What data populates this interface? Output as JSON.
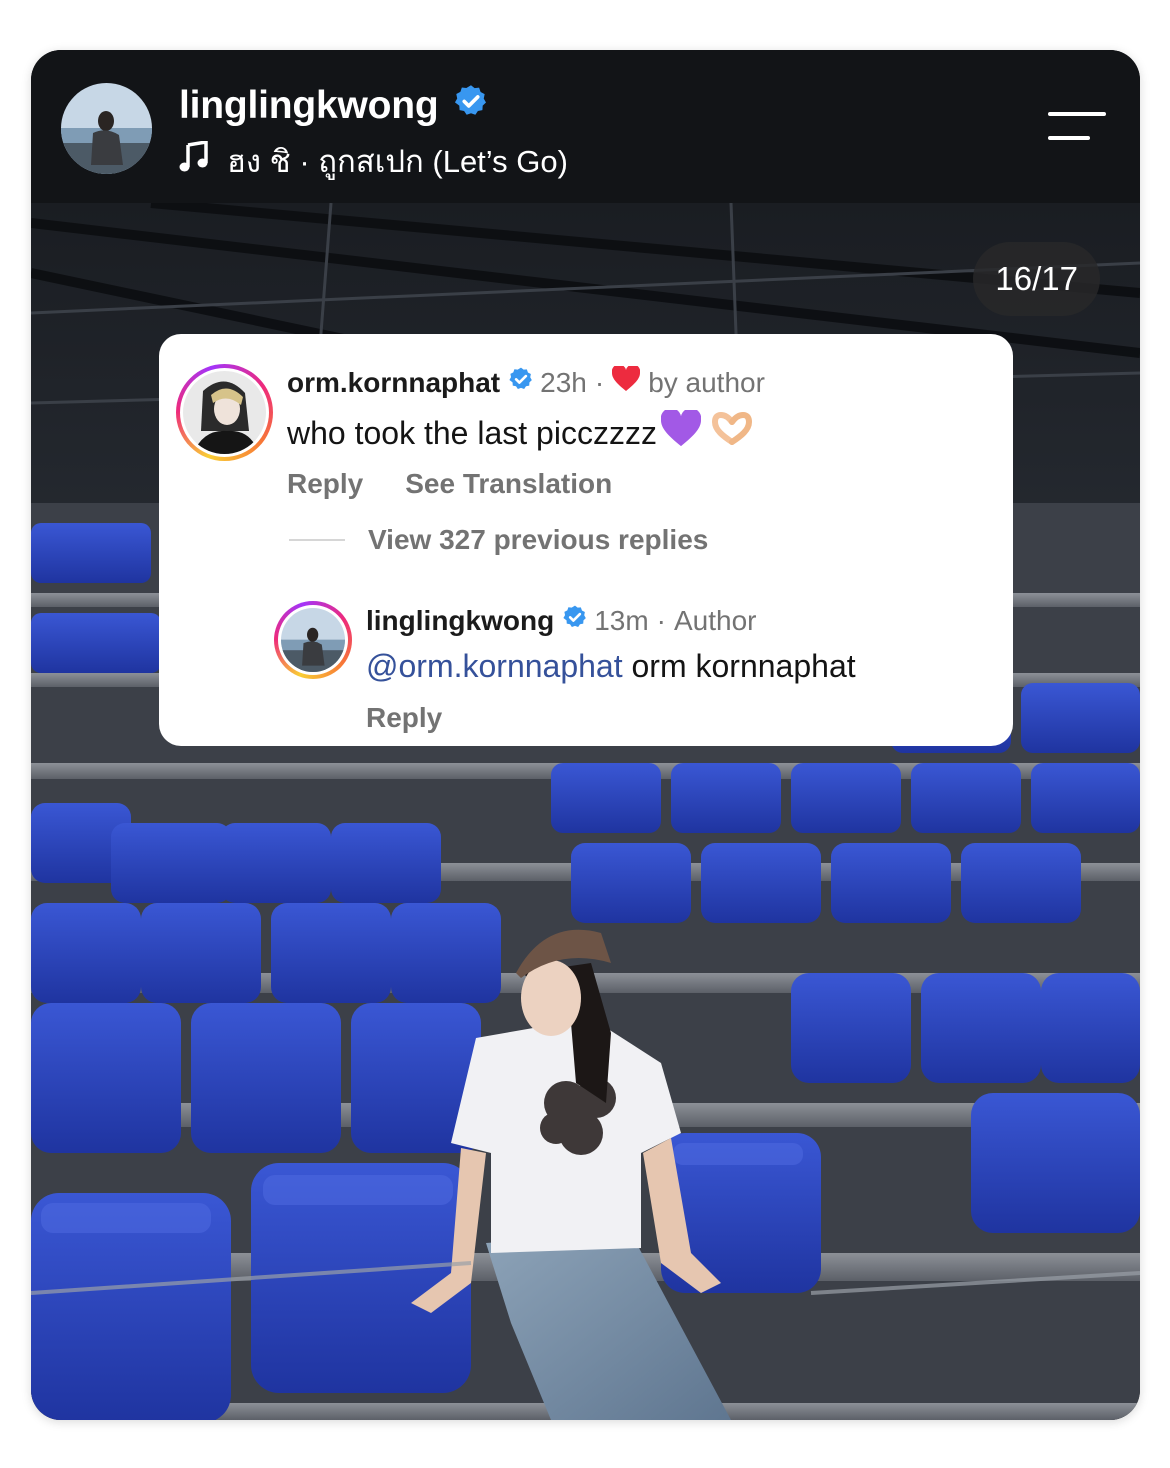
{
  "post": {
    "username": "linglingkwong",
    "music": "ฮง ชิ · ถูกสเปก (Let’s Go)",
    "slide_counter": "16/17"
  },
  "comment": {
    "username": "orm.kornnaphat",
    "time": "23h",
    "sep": "·",
    "liked_label": "by author",
    "text": "who took the last picczzzz",
    "reply_label": "Reply",
    "translate_label": "See Translation",
    "view_replies": "View 327 previous replies"
  },
  "reply": {
    "username": "linglingkwong",
    "time": "13m",
    "sep": "·",
    "author_label": "Author",
    "mention": "@orm.kornnaphat",
    "text": " orm kornnaphat",
    "reply_label": "Reply"
  },
  "colors": {
    "verified": "#3897f0",
    "heart": "#ed2b3f",
    "mention": "#35519a",
    "seat_blue": "#2d44b8"
  },
  "icons": {
    "verified": "verified-badge-icon",
    "music": "music-note-icon",
    "menu": "menu-icon",
    "heart": "heart-icon"
  }
}
